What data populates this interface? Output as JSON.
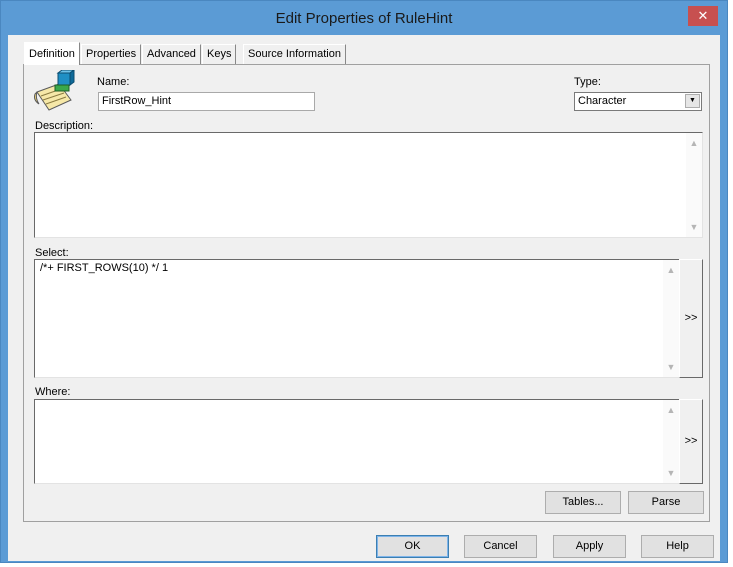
{
  "window": {
    "title": "Edit Properties of RuleHint",
    "close_glyph": "✕"
  },
  "tabs": [
    {
      "label": "Definition",
      "active": true
    },
    {
      "label": "Properties",
      "active": false
    },
    {
      "label": "Advanced",
      "active": false
    },
    {
      "label": "Keys",
      "active": false
    },
    {
      "label": "Source Information",
      "active": false
    }
  ],
  "form": {
    "name_label": "Name:",
    "name_value": "FirstRow_Hint",
    "type_label": "Type:",
    "type_value": "Character",
    "description_label": "Description:",
    "description_value": "",
    "select_label": "Select:",
    "select_value": "/*+ FIRST_ROWS(10) */ 1",
    "where_label": "Where:",
    "where_value": "",
    "select_expand": ">>",
    "where_expand": ">>",
    "tables_button": "Tables...",
    "parse_button": "Parse"
  },
  "footer": {
    "ok": "OK",
    "cancel": "Cancel",
    "apply": "Apply",
    "help": "Help"
  },
  "icons": {
    "rulehint": "rulehint-icon",
    "dropdown": "chevron-down-icon"
  },
  "colors": {
    "title_bar": "#5b9bd5",
    "close": "#c75050"
  }
}
